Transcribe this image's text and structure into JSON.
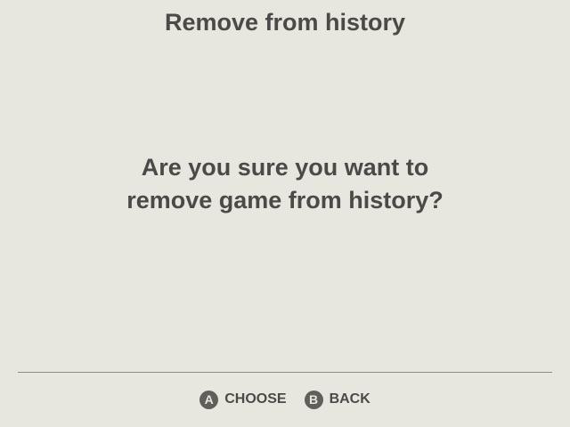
{
  "screen": {
    "title": "Remove from history",
    "message_line1": "Are you sure you want to",
    "message_line2": "remove game from history?"
  },
  "footer": {
    "hints": [
      {
        "button": "A",
        "label": "CHOOSE",
        "icon": "a-button-icon"
      },
      {
        "button": "B",
        "label": "BACK",
        "icon": "b-button-icon"
      }
    ]
  },
  "colors": {
    "background": "#e8e7df",
    "text": "#4a4a48",
    "button_glyph": "#5f5f5b",
    "divider": "#8a8a86"
  }
}
